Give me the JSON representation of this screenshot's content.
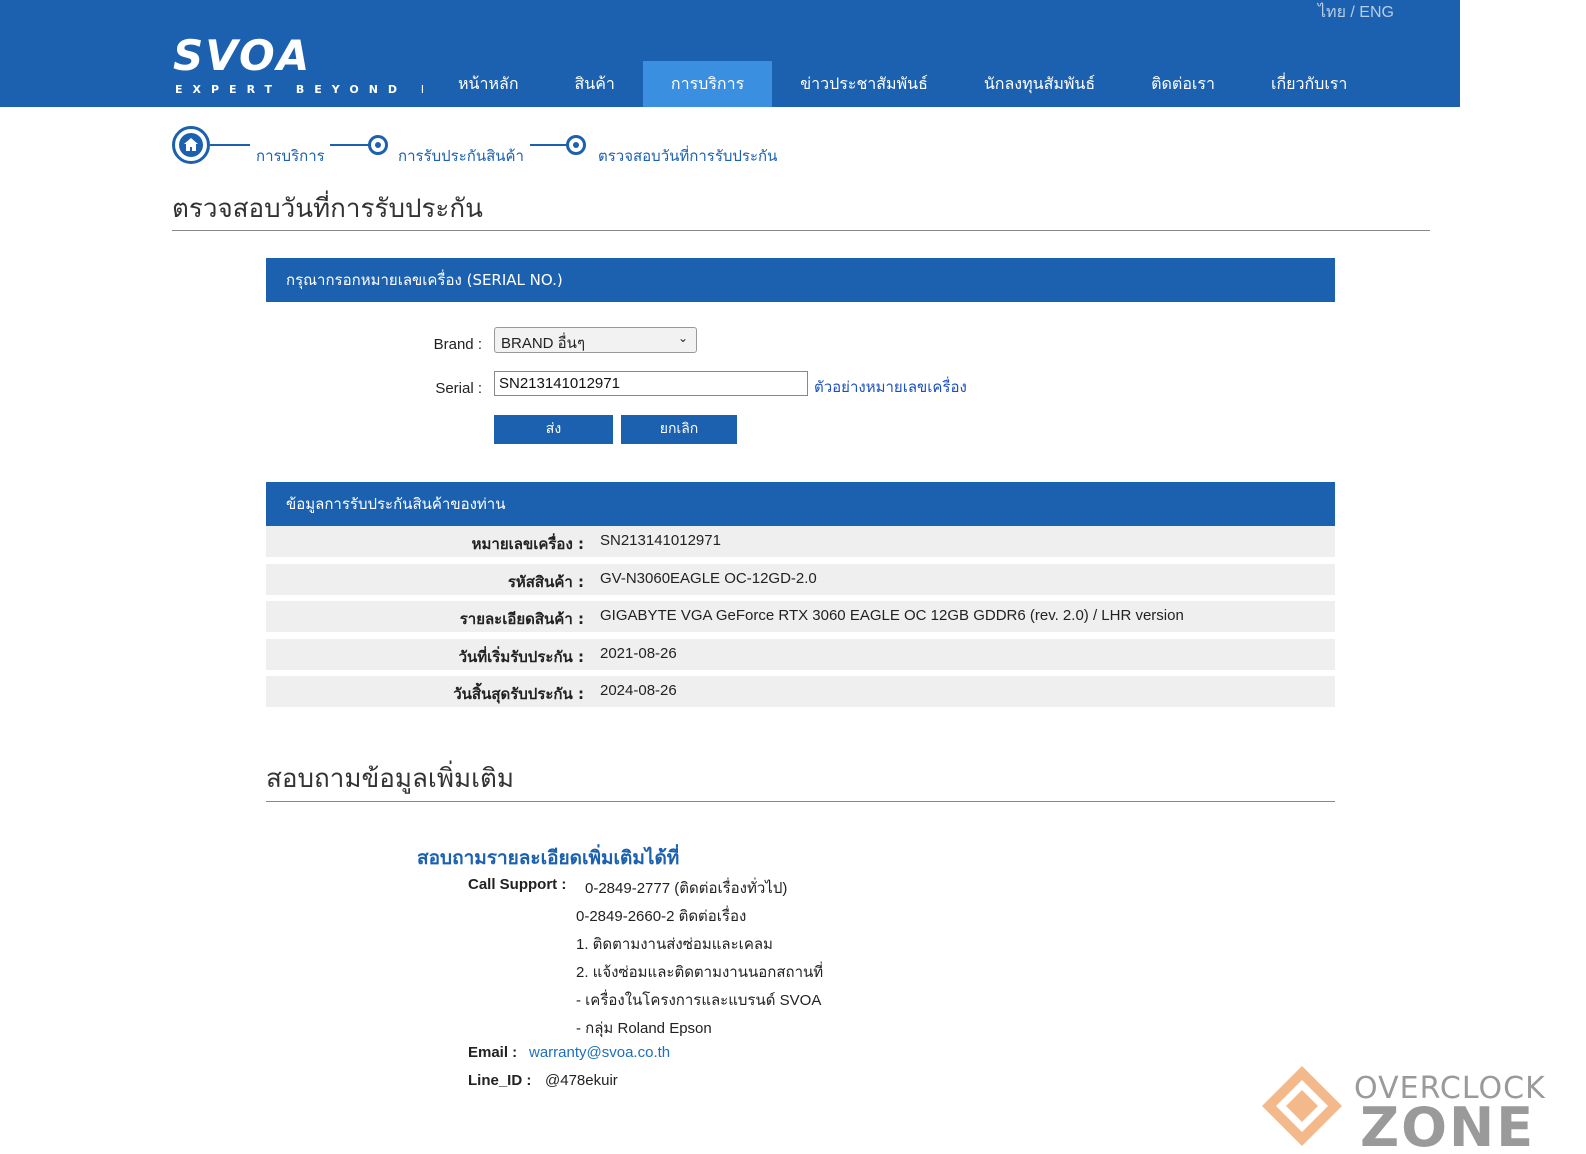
{
  "header": {
    "lang": "ไทย / ENG",
    "logo_text": "SVOA",
    "logo_tagline": "EXPERT BEYOND IT",
    "nav": [
      {
        "label": "หน้าหลัก"
      },
      {
        "label": "สินค้า"
      },
      {
        "label": "การบริการ",
        "active": true
      },
      {
        "label": "ข่าวประชาสัมพันธ์"
      },
      {
        "label": "นักลงทุนสัมพันธ์"
      },
      {
        "label": "ติดต่อเรา"
      },
      {
        "label": "เกี่ยวกับเรา"
      }
    ]
  },
  "breadcrumb": {
    "items": [
      "การบริการ",
      "การรับประกันสินค้า",
      "ตรวจสอบวันที่การรับประกัน"
    ]
  },
  "page_title": "ตรวจสอบวันที่การรับประกัน",
  "form": {
    "header": "กรุณากรอกหมายเลขเครื่อง (SERIAL NO.)",
    "brand_label": "Brand :",
    "brand_value": "BRAND อื่นๆ",
    "serial_label": "Serial :",
    "serial_value": "SN213141012971",
    "sample_link": "ตัวอย่างหมายเลขเครื่อง",
    "submit_label": "ส่ง",
    "cancel_label": "ยกเลิก"
  },
  "warranty": {
    "header": "ข้อมูลการรับประกันสินค้าของท่าน",
    "rows": [
      {
        "label": "หมายเลขเครื่อง :",
        "value": "SN213141012971"
      },
      {
        "label": "รหัสสินค้า :",
        "value": "GV-N3060EAGLE OC-12GD-2.0"
      },
      {
        "label": "รายละเอียดสินค้า :",
        "value": "GIGABYTE VGA GeForce RTX 3060 EAGLE OC 12GB GDDR6 (rev. 2.0) / LHR version"
      },
      {
        "label": "วันที่เริ่มรับประกัน :",
        "value": "2021-08-26"
      },
      {
        "label": "วันสิ้นสุดรับประกัน :",
        "value": "2024-08-26"
      }
    ]
  },
  "contact": {
    "section_title": "สอบถามข้อมูลเพิ่มเติม",
    "title": "สอบถามรายละเอียดเพิ่มเติมได้ที่",
    "call_label": "Call Support :",
    "call_lines": [
      "0-2849-2777 (ติดต่อเรื่องทั่วไป)",
      "0-2849-2660-2 ติดต่อเรื่อง",
      "1. ติดตามงานส่งซ่อมและเคลม",
      "2. แจ้งซ่อมและติดตามงานนอกสถานที่",
      "- เครื่องในโครงการและแบรนด์ SVOA",
      "- กลุ่ม Roland Epson"
    ],
    "email_label": "Email :",
    "email_value": "warranty@svoa.co.th",
    "line_label": "Line_ID :",
    "line_value": "@478ekuir"
  },
  "watermark": {
    "line1": "OVERCLOCK",
    "line2": "ZONE"
  },
  "colors": {
    "brand_blue": "#1c60b0",
    "nav_active": "#3a8fe0",
    "link_blue": "#1c4fc0"
  }
}
